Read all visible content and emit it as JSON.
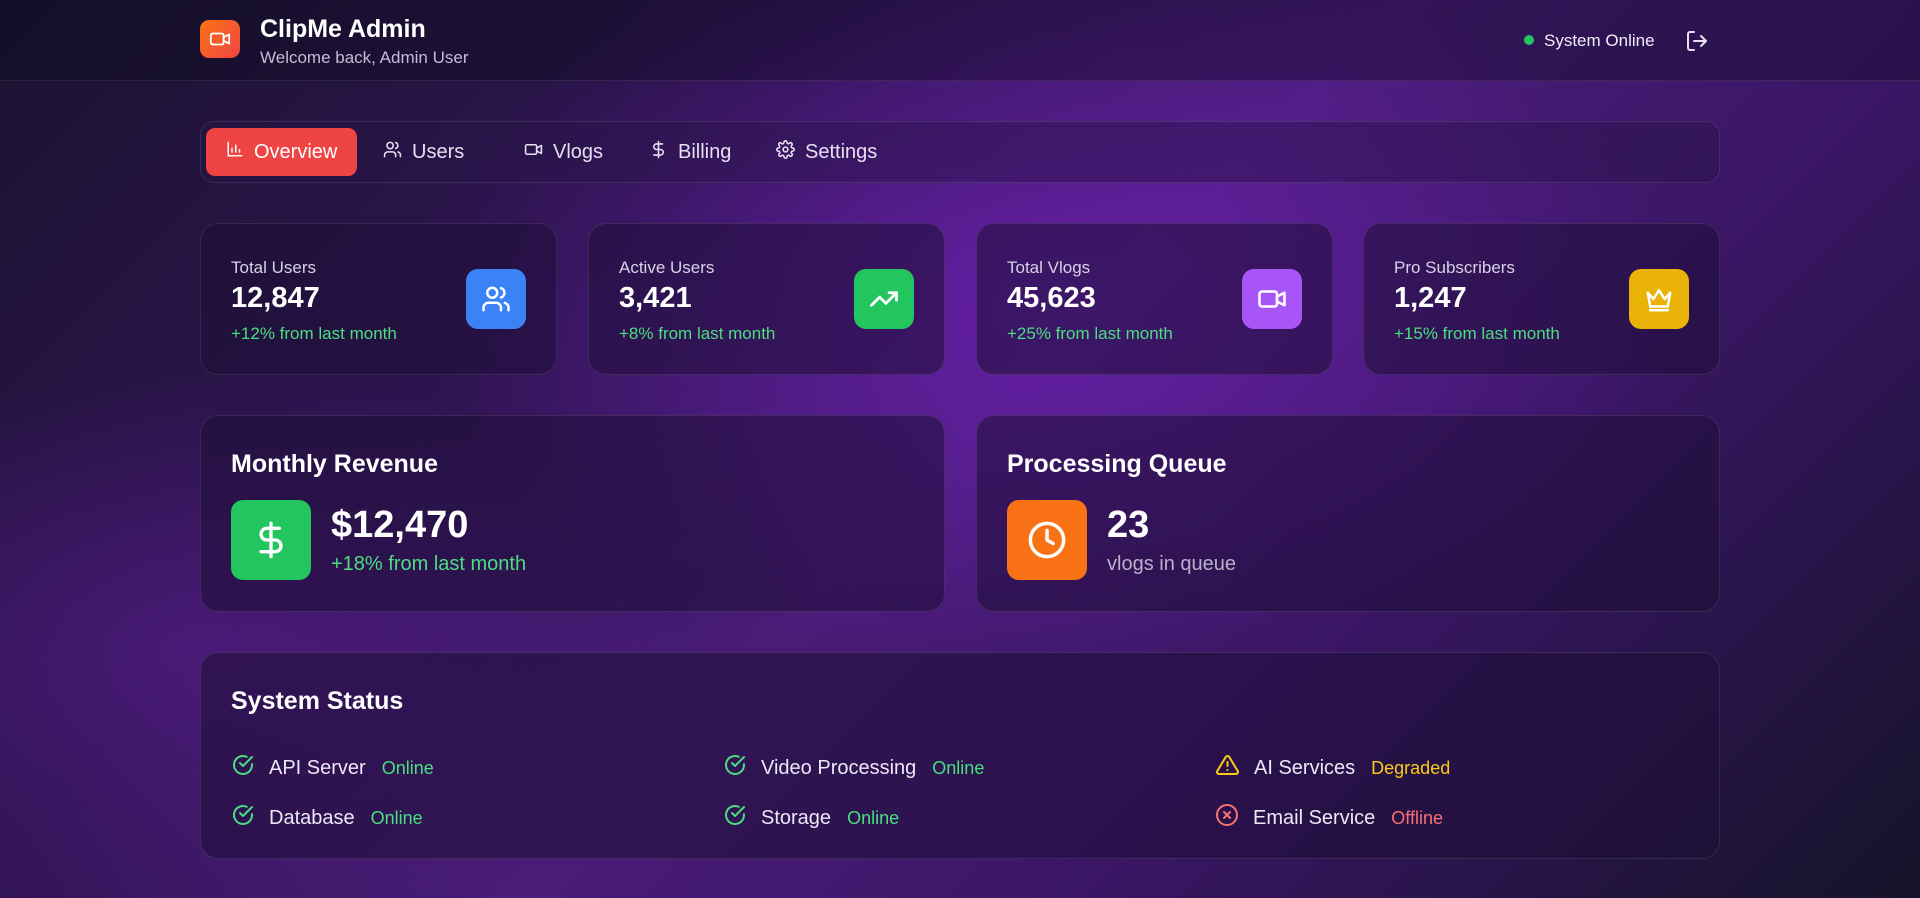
{
  "header": {
    "title": "ClipMe Admin",
    "subtitle": "Welcome back, Admin User",
    "status": "System Online",
    "status_color": "#22c55e",
    "brand_icon": "video-camera-icon",
    "logout_icon": "logout-icon"
  },
  "tabs": [
    {
      "label": "Overview",
      "icon": "bar-chart-icon",
      "active": true
    },
    {
      "label": "Users",
      "icon": "users-icon",
      "active": false
    },
    {
      "label": "Vlogs",
      "icon": "video-icon",
      "active": false
    },
    {
      "label": "Billing",
      "icon": "dollar-icon",
      "active": false
    },
    {
      "label": "Settings",
      "icon": "gear-icon",
      "active": false
    }
  ],
  "stats": [
    {
      "label": "Total Users",
      "value": "12,847",
      "change": "+12% from last month",
      "icon": "users-icon",
      "color": "#3b82f6"
    },
    {
      "label": "Active Users",
      "value": "3,421",
      "change": "+8% from last month",
      "icon": "trending-up-icon",
      "color": "#22c55e"
    },
    {
      "label": "Total Vlogs",
      "value": "45,623",
      "change": "+25% from last month",
      "icon": "video-icon",
      "color": "#a855f7"
    },
    {
      "label": "Pro Subscribers",
      "value": "1,247",
      "change": "+15% from last month",
      "icon": "crown-icon",
      "color": "#eab308"
    }
  ],
  "revenue": {
    "title": "Monthly Revenue",
    "value": "$12,470",
    "change": "+18% from last month",
    "icon": "dollar-icon",
    "color": "#22c55e"
  },
  "queue": {
    "title": "Processing Queue",
    "value": "23",
    "sub": "vlogs in queue",
    "icon": "clock-icon",
    "color": "#f97316"
  },
  "system_status": {
    "title": "System Status",
    "items": [
      {
        "name": "API Server",
        "state": "Online",
        "icon": "check-circle-icon",
        "color": "#4ade80"
      },
      {
        "name": "Video Processing",
        "state": "Online",
        "icon": "check-circle-icon",
        "color": "#4ade80"
      },
      {
        "name": "AI Services",
        "state": "Degraded",
        "icon": "warning-icon",
        "color": "#facc15"
      },
      {
        "name": "Database",
        "state": "Online",
        "icon": "check-circle-icon",
        "color": "#4ade80"
      },
      {
        "name": "Storage",
        "state": "Online",
        "icon": "check-circle-icon",
        "color": "#4ade80"
      },
      {
        "name": "Email Service",
        "state": "Offline",
        "icon": "x-circle-icon",
        "color": "#f87171"
      }
    ]
  }
}
